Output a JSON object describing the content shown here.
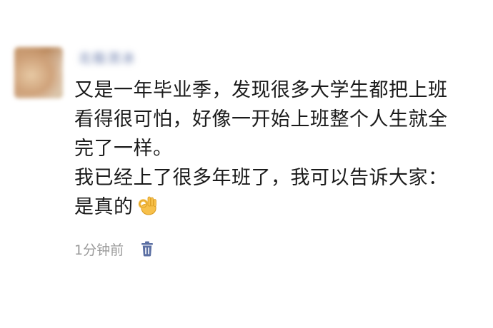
{
  "post": {
    "username": "北极流冰",
    "content_lines": [
      "又是一年毕业季，发现很多大学生都把上班",
      "看得很可怕，好像一开始上班整个人生就全",
      "完了一样。",
      "我已经上了很多年班了，我可以告诉大家：",
      "是真的"
    ],
    "emoji": "ok-hand-emoji",
    "timestamp": "1分钟前",
    "delete_icon": "trash-icon",
    "colors": {
      "username": "#5b6fa3",
      "text": "#1b1b1b",
      "timestamp": "#9a9a9a",
      "delete_icon": "#5b6fa3",
      "emoji": "#f6b93b"
    }
  }
}
